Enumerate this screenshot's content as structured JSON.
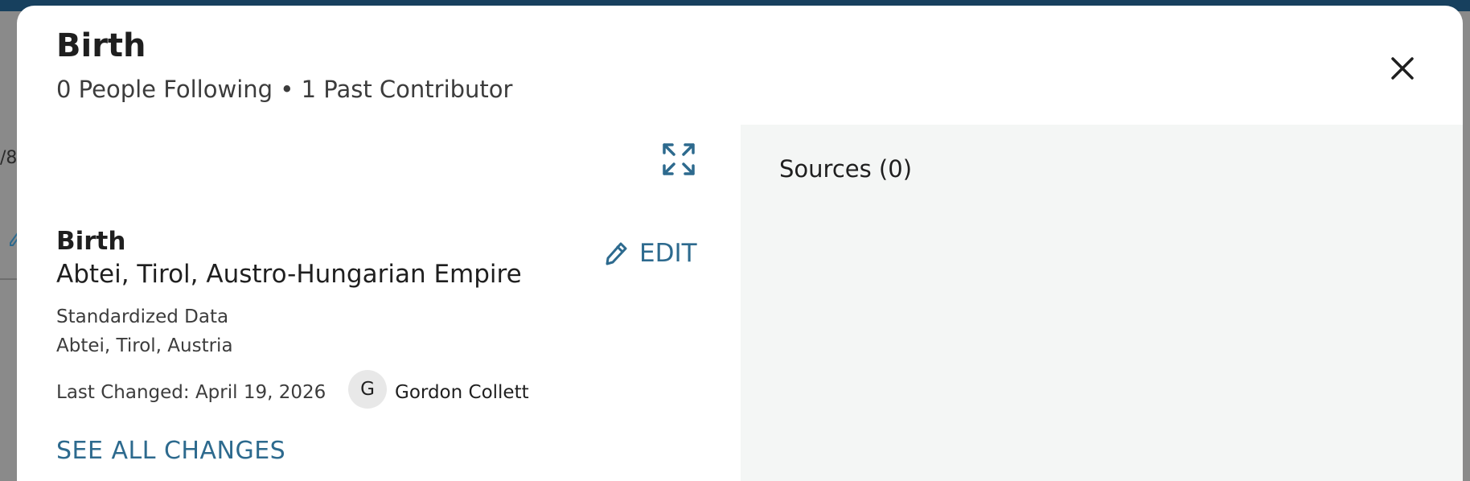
{
  "backdrop": {
    "peek_text": "/8",
    "peek_icon": "pencil-icon"
  },
  "modal": {
    "title": "Birth",
    "subtitle": "0 People Following • 1 Past Contributor",
    "close_icon": "close-icon"
  },
  "event": {
    "expand_icon": "expand-icon",
    "type": "Birth",
    "place": "Abtei, Tirol, Austro-Hungarian Empire",
    "edit_label": "EDIT",
    "edit_icon": "pencil-icon",
    "standardized_label": "Standardized Data",
    "standardized_value": "Abtei, Tirol, Austria",
    "last_changed": "Last Changed: April 19, 2026",
    "contributor_initial": "G",
    "contributor_name": "Gordon Collett",
    "see_all_label": "SEE ALL CHANGES"
  },
  "sources": {
    "heading": "Sources (0)"
  },
  "colors": {
    "accent": "#2d6a8e",
    "text": "#1f1f1f",
    "panel_bg": "#f4f6f5",
    "header_bar": "#17405e"
  }
}
